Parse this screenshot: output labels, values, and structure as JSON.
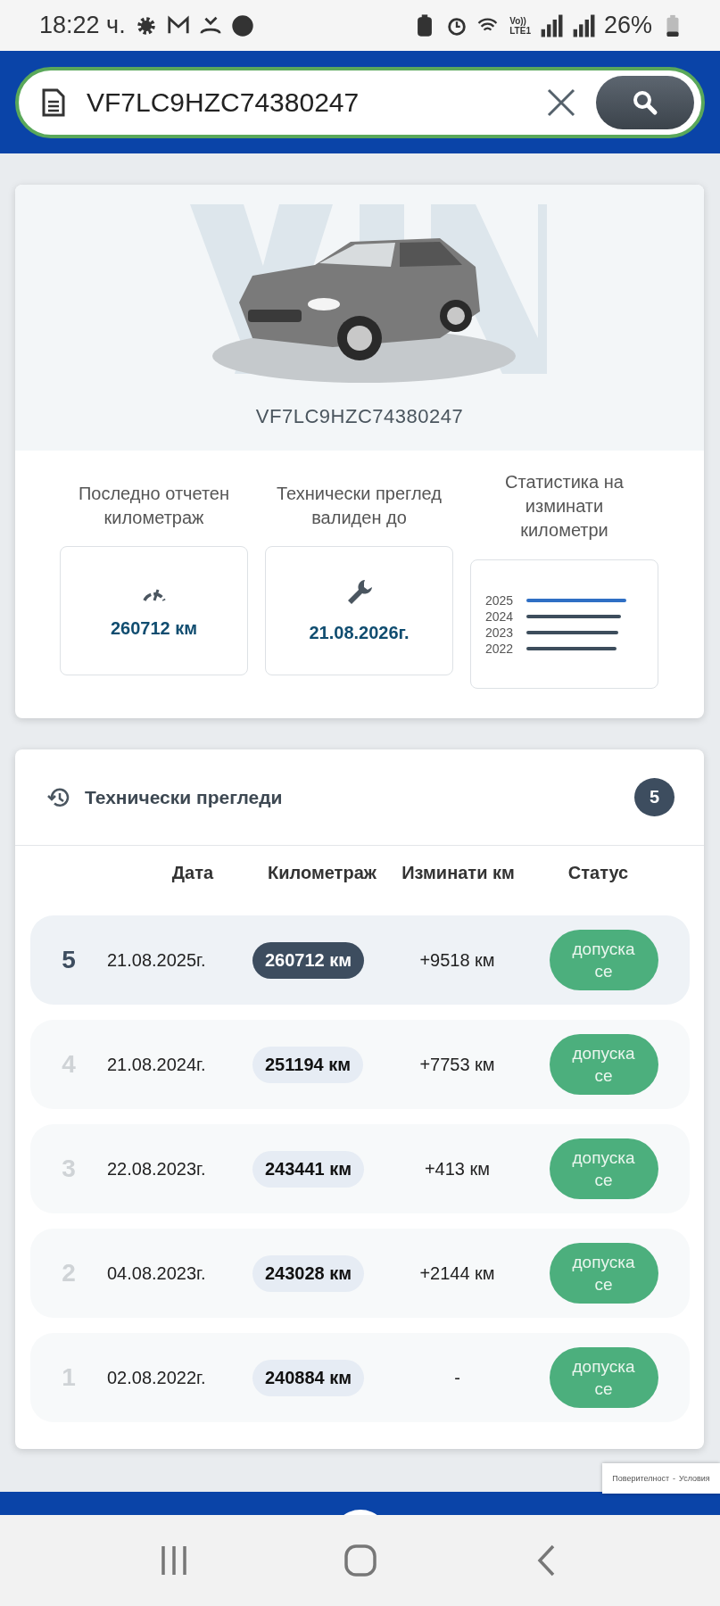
{
  "status_bar": {
    "time": "18:22 ч.",
    "network": [
      "Vo))",
      "LTE1"
    ],
    "battery": "26%"
  },
  "search": {
    "value": "VF7LC9HZC74380247"
  },
  "vehicle": {
    "vin": "VF7LC9HZC74380247"
  },
  "stats": [
    {
      "kind": "value",
      "label": "Последно отчетен километраж",
      "value": "260712 км"
    },
    {
      "kind": "value",
      "label": "Технически преглед валиден до",
      "value": "21.08.2026г."
    },
    {
      "kind": "chart",
      "label": "Статистика на изминати километри",
      "years": [
        {
          "year": "2025",
          "color": "#2f6fc4"
        },
        {
          "year": "2024",
          "color": "#3d4d5c"
        },
        {
          "year": "2023",
          "color": "#3d4d5c"
        },
        {
          "year": "2022",
          "color": "#3d4d5c"
        }
      ]
    }
  ],
  "inspections": {
    "title": "Технически прегледи",
    "count": "5",
    "columns": [
      "Дата",
      "Километраж",
      "Изминати км",
      "Статус"
    ],
    "rows": [
      {
        "number": "5",
        "date": "21.08.2025г.",
        "mileage": "260712 км",
        "delta": "+9518 км",
        "status": "допуска се",
        "selected": true
      },
      {
        "number": "4",
        "date": "21.08.2024г.",
        "mileage": "251194 км",
        "delta": "+7753 км",
        "status": "допуска се",
        "selected": false
      },
      {
        "number": "3",
        "date": "22.08.2023г.",
        "mileage": "243441 км",
        "delta": "+413 км",
        "status": "допуска се",
        "selected": false
      },
      {
        "number": "2",
        "date": "04.08.2023г.",
        "mileage": "243028 км",
        "delta": "+2144 км",
        "status": "допуска се",
        "selected": false
      },
      {
        "number": "1",
        "date": "02.08.2022г.",
        "mileage": "240884 км",
        "delta": "-",
        "status": "допуска се",
        "selected": false
      }
    ]
  },
  "recaptcha": {
    "links": [
      "Поверителност",
      "-",
      "Условия"
    ]
  }
}
